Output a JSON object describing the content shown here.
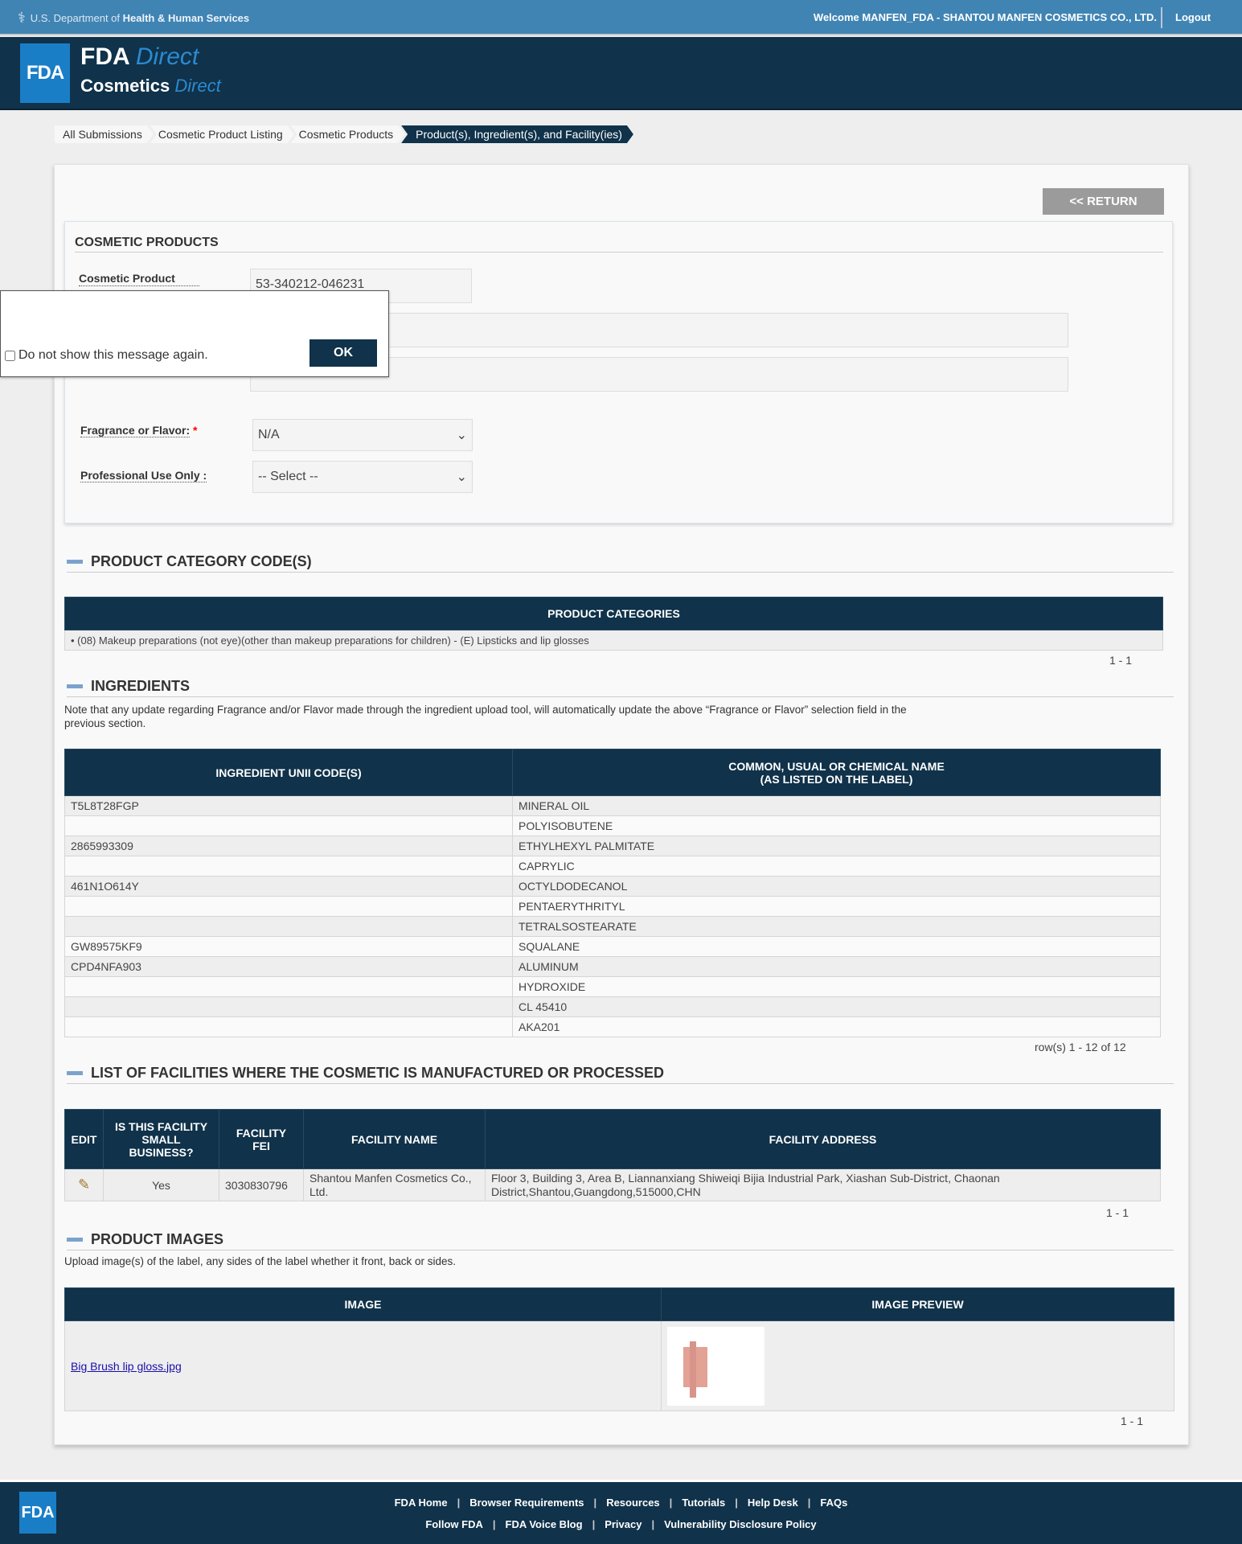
{
  "topbar": {
    "hhs_prefix": "U.S. Department of ",
    "hhs_bold": "Health & Human Services",
    "welcome": "Welcome MANFEN_FDA - SHANTOU MANFEN COSMETICS CO., LTD.",
    "logout": "Logout"
  },
  "header": {
    "logo": "FDA",
    "brand1a": "FDA ",
    "brand1b": "Direct",
    "brand2a": "Cosmetics ",
    "brand2b": "Direct"
  },
  "breadcrumb": [
    "All Submissions",
    "Cosmetic Product Listing",
    "Cosmetic Products",
    "Product(s), Ingredient(s), and Facility(ies)"
  ],
  "return_label": "<< RETURN",
  "cosmetic": {
    "title": "COSMETIC PRODUCTS",
    "listing_label": "Cosmetic Product Listing Number:",
    "listing_value": "53-340212-046231",
    "fragrance_label": "Fragrance or Flavor:",
    "fragrance_value": "N/A",
    "prof_label": "Professional Use Only :",
    "prof_value": "-- Select --",
    "required_mark": "*"
  },
  "popup": {
    "checkbox_label": "Do not show this message again.",
    "ok": "OK"
  },
  "categories": {
    "title": "PRODUCT CATEGORY CODE(S)",
    "header": "PRODUCT CATEGORIES",
    "items": [
      "(08) Makeup preparations (not eye)(other than makeup preparations for children) - (E) Lipsticks and lip glosses"
    ],
    "pager": "1 - 1"
  },
  "ingredients": {
    "title": "INGREDIENTS",
    "note": "Note that any update regarding Fragrance and/or Flavor made through the ingredient upload tool, will automatically update the above “Fragrance or Flavor” selection field in the previous section.",
    "col1": "INGREDIENT UNII CODE(S)",
    "col2a": "COMMON, USUAL OR CHEMICAL NAME",
    "col2b": "(AS LISTED ON THE LABEL)",
    "rows": [
      [
        "T5L8T28FGP",
        "MINERAL OIL"
      ],
      [
        "",
        "POLYISOBUTENE"
      ],
      [
        "2865993309",
        "ETHYLHEXYL PALMITATE"
      ],
      [
        "",
        "CAPRYLIC"
      ],
      [
        "461N1O614Y",
        "OCTYLDODECANOL"
      ],
      [
        "",
        "PENTAERYTHRITYL"
      ],
      [
        "",
        "TETRALSOSTEARATE"
      ],
      [
        "GW89575KF9",
        "SQUALANE"
      ],
      [
        "CPD4NFA903",
        "ALUMINUM"
      ],
      [
        "",
        "HYDROXIDE"
      ],
      [
        "",
        "CL 45410"
      ],
      [
        "",
        "AKA201"
      ]
    ],
    "pager": "row(s) 1 - 12 of 12"
  },
  "facilities": {
    "title": "LIST OF FACILITIES WHERE THE COSMETIC IS MANUFACTURED OR PROCESSED",
    "cols": [
      "EDIT",
      "IS THIS FACILITY SMALL BUSINESS?",
      "FACILITY FEI",
      "FACILITY NAME",
      "FACILITY ADDRESS"
    ],
    "rows": [
      {
        "small": "Yes",
        "fei": "3030830796",
        "name": "Shantou Manfen Cosmetics Co., Ltd.",
        "address": "Floor 3, Building 3, Area B, Liannanxiang Shiweiqi Bijia Industrial Park, Xiashan Sub-District, Chaonan District,Shantou,Guangdong,515000,CHN"
      }
    ],
    "pager": "1 - 1"
  },
  "images": {
    "title": "PRODUCT IMAGES",
    "note": "Upload image(s) of the label, any sides of the label whether it front, back or sides.",
    "col1": "IMAGE",
    "col2": "IMAGE PREVIEW",
    "file": "Big Brush lip gloss.jpg",
    "pager": "1 - 1"
  },
  "footer": {
    "logo": "FDA",
    "row1": [
      "FDA Home",
      "Browser Requirements",
      "Resources",
      "Tutorials",
      "Help Desk",
      "FAQs"
    ],
    "row2": [
      "Follow FDA",
      "FDA Voice Blog",
      "Privacy",
      "Vulnerability Disclosure Policy"
    ]
  }
}
